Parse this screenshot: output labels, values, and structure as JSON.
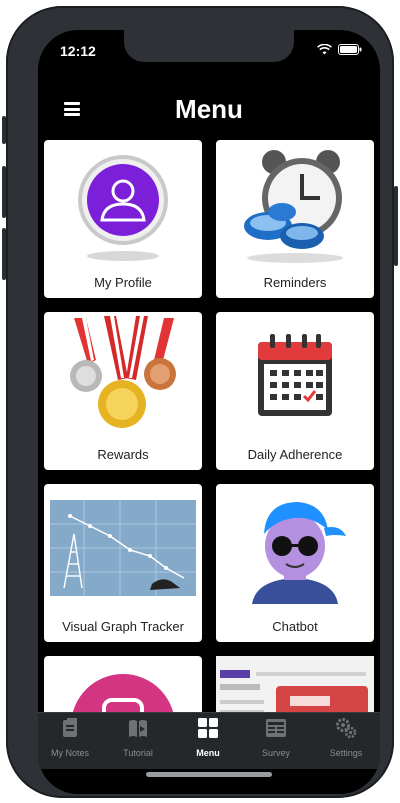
{
  "status": {
    "time": "12:12"
  },
  "header": {
    "title": "Menu"
  },
  "menu": {
    "items": [
      {
        "label": "My Profile"
      },
      {
        "label": "Reminders"
      },
      {
        "label": "Rewards"
      },
      {
        "label": "Daily Adherence"
      },
      {
        "label": "Visual Graph Tracker"
      },
      {
        "label": "Chatbot"
      },
      {
        "label": ""
      },
      {
        "label": ""
      }
    ]
  },
  "tabs": [
    {
      "label": "My Notes",
      "icon": "notes-icon"
    },
    {
      "label": "Tutorial",
      "icon": "book-icon"
    },
    {
      "label": "Menu",
      "icon": "grid-icon",
      "active": true
    },
    {
      "label": "Survey",
      "icon": "survey-icon"
    },
    {
      "label": "Settings",
      "icon": "gear-icon"
    }
  ],
  "colors": {
    "accent": "#7b1fd8",
    "card": "#ffffff",
    "background": "#000000",
    "tabbar": "#25282b"
  }
}
